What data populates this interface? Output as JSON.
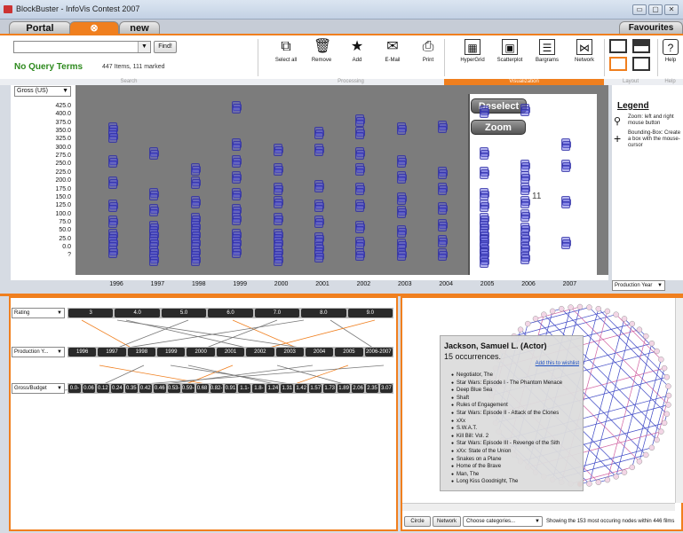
{
  "window": {
    "title": "BlockBuster - InfoVis Contest 2007",
    "min": "▭",
    "max": "▢",
    "close": "✕"
  },
  "tabs": {
    "portal": "Portal",
    "new": "new",
    "favourites": "Favourites"
  },
  "toolbar": {
    "find": "Find!",
    "no_query": "No Query Terms",
    "query_count": "447 Items, 111 marked",
    "groups": {
      "search": "Search",
      "processing": "Processing",
      "visualization": "Visualization",
      "layout": "Layout",
      "help": "Help"
    },
    "processing": [
      {
        "label": "Select all",
        "icon": "select-all-icon",
        "glyph": "⧉"
      },
      {
        "label": "Remove",
        "icon": "trash-icon",
        "glyph": "🗑"
      },
      {
        "label": "Add",
        "icon": "star-icon",
        "glyph": "★"
      },
      {
        "label": "E-Mail",
        "icon": "envelope-icon",
        "glyph": "✉"
      },
      {
        "label": "Print",
        "icon": "printer-icon",
        "glyph": "⎙"
      }
    ],
    "visualization": [
      {
        "label": "HyperGrid",
        "icon": "hypergrid-icon",
        "glyph": "▦"
      },
      {
        "label": "Scatterplot",
        "icon": "scatterplot-icon",
        "glyph": "▣"
      },
      {
        "label": "Bargrams",
        "icon": "bargrams-icon",
        "glyph": "☰"
      },
      {
        "label": "Network",
        "icon": "network-icon",
        "glyph": "⋈"
      }
    ],
    "help": "Help"
  },
  "scatter": {
    "y_select": "Gross (US)",
    "x_select": "Production Year",
    "y_ticks": [
      "425.0",
      "400.0",
      "375.0",
      "350.0",
      "325.0",
      "300.0",
      "275.0",
      "250.0",
      "225.0",
      "200.0",
      "175.0",
      "150.0",
      "125.0",
      "100.0",
      "75.0",
      "50.0",
      "25.0",
      "0.0",
      "?"
    ],
    "x_ticks": [
      "1996",
      "1997",
      "1998",
      "1999",
      "2000",
      "2001",
      "2002",
      "2003",
      "2004",
      "2005",
      "2006",
      "2007"
    ],
    "deselect": "Deselect",
    "zoom": "Zoom",
    "marked_count": "11",
    "legend_title": "Legend",
    "legend_zoom": "Zoom: left and right mouse button",
    "legend_bbox": "Bounding-Box: Create a box with the mouse-cursor"
  },
  "parallel": {
    "rows": [
      {
        "select": "Rating",
        "chips": [
          "3",
          "4.0",
          "5.0",
          "6.0",
          "7.0",
          "8.0",
          "9.0"
        ]
      },
      {
        "select": "Production Y...",
        "chips": [
          "1996",
          "1997",
          "1998",
          "1999",
          "2000",
          "2001",
          "2002",
          "2003",
          "2004",
          "2005",
          "2006-2007"
        ]
      },
      {
        "select": "Gross/Budget",
        "chips": [
          "0.0-",
          "0.06",
          "0.12",
          "0.24",
          "0.35",
          "0.42",
          "0.46",
          "0.53-",
          "0.59-",
          "0.68",
          "0.82-",
          "0.91",
          "1.1-",
          "1.8-",
          "1.24",
          "1.31",
          "1.42",
          "1.57",
          "1.73",
          "1.89",
          "2.06",
          "2.35",
          "3.07"
        ]
      }
    ]
  },
  "network": {
    "popup_name": "Jackson, Samuel L. (Actor)",
    "popup_occ": "15 occurrences.",
    "wishlist": "Add this to wishlist",
    "films": [
      "Negotiator, The",
      "Star Wars: Episode I - The Phantom Menace",
      "Deep Blue Sea",
      "Shaft",
      "Rules of Engagement",
      "Star Wars: Episode II - Attack of the Clones",
      "xXx",
      "S.W.A.T.",
      "Kill Bill: Vol. 2",
      "Star Wars: Episode III - Revenge of the Sith",
      "xXx: State of the Union",
      "Snakes on a Plane",
      "Home of the Brave",
      "Man, The",
      "Long Kiss Goodnight, The"
    ],
    "circle_btn": "Circle",
    "network_btn": "Network",
    "categories": "Choose categories...",
    "summary": "Showing the 153 most occuring nodes within 446 films"
  },
  "colors": {
    "accent": "#f07f1e",
    "green": "#2e8a1e"
  }
}
